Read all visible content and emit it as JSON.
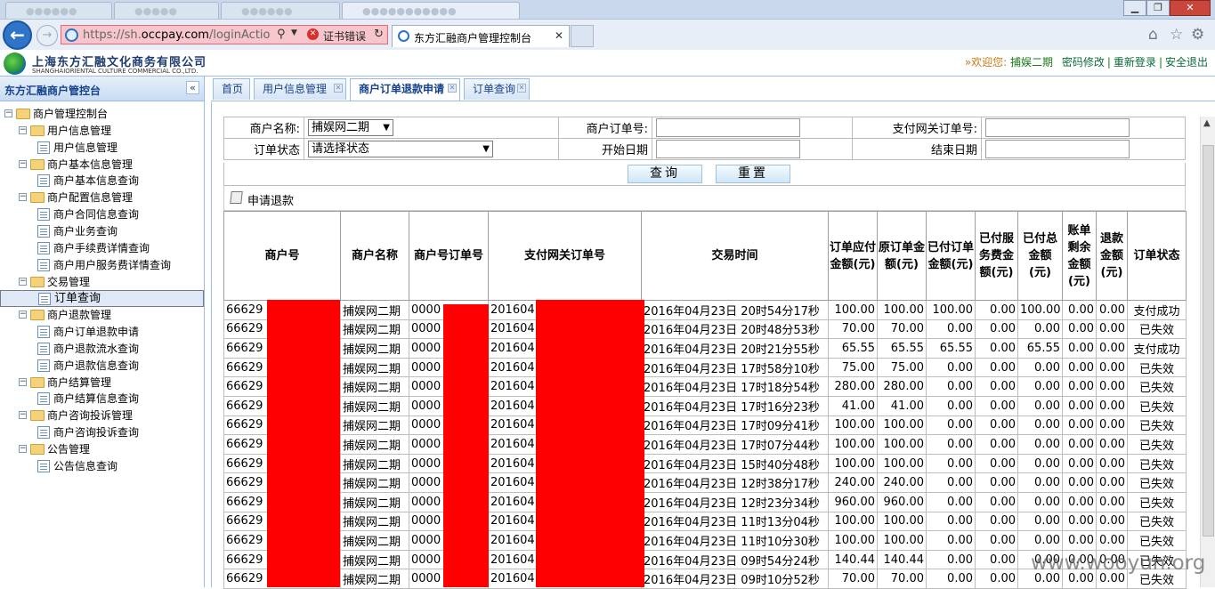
{
  "browser": {
    "url_prefix": "https://sh.",
    "url_domain": "occpay.com",
    "url_rest": "/loginAction.ac",
    "cert_error": "证书错误",
    "tab_title": "东方汇融商户管理控制台"
  },
  "header": {
    "company_cn": "上海东方汇融文化商务有限公司",
    "company_en": "SHANGHAIORIENTAL CULTURE COMMERCIAL CO.,LTD.",
    "welcome_label": "»欢迎您: ",
    "username": "捕娱二期",
    "links": [
      "密码修改",
      "重新登录",
      "安全退出"
    ]
  },
  "sidebar": {
    "title": "东方汇融商户管控台",
    "collapse_glyph": "«",
    "nodes": [
      {
        "label": "商户管理控制台",
        "level": 0,
        "type": "folder"
      },
      {
        "label": "用户信息管理",
        "level": 1,
        "type": "folder"
      },
      {
        "label": "用户信息管理",
        "level": 2,
        "type": "page"
      },
      {
        "label": "商户基本信息管理",
        "level": 1,
        "type": "folder"
      },
      {
        "label": "商户基本信息查询",
        "level": 2,
        "type": "page"
      },
      {
        "label": "商户配置信息管理",
        "level": 1,
        "type": "folder"
      },
      {
        "label": "商户合同信息查询",
        "level": 2,
        "type": "page"
      },
      {
        "label": "商户业务查询",
        "level": 2,
        "type": "page"
      },
      {
        "label": "商户手续费详情查询",
        "level": 2,
        "type": "page"
      },
      {
        "label": "商户用户服务费详情查询",
        "level": 2,
        "type": "page"
      },
      {
        "label": "交易管理",
        "level": 1,
        "type": "folder"
      },
      {
        "label": "订单查询",
        "level": 2,
        "type": "page",
        "selected": true
      },
      {
        "label": "商户退款管理",
        "level": 1,
        "type": "folder"
      },
      {
        "label": "商户订单退款申请",
        "level": 2,
        "type": "page"
      },
      {
        "label": "商户退款流水查询",
        "level": 2,
        "type": "page"
      },
      {
        "label": "商户退款信息查询",
        "level": 2,
        "type": "page"
      },
      {
        "label": "商户结算管理",
        "level": 1,
        "type": "folder"
      },
      {
        "label": "商户结算信息查询",
        "level": 2,
        "type": "page"
      },
      {
        "label": "商户咨询投诉管理",
        "level": 1,
        "type": "folder"
      },
      {
        "label": "商户咨询投诉查询",
        "level": 2,
        "type": "page"
      },
      {
        "label": "公告管理",
        "level": 1,
        "type": "folder"
      },
      {
        "label": "公告信息查询",
        "level": 2,
        "type": "page"
      }
    ]
  },
  "tabs": [
    {
      "label": "首页",
      "closable": false,
      "active": false
    },
    {
      "label": "用户信息管理",
      "closable": true,
      "active": false
    },
    {
      "label": "商户订单退款申请",
      "closable": true,
      "active": true
    },
    {
      "label": "订单查询",
      "closable": true,
      "active": false
    }
  ],
  "query": {
    "merchant_name_label": "商户名称:",
    "merchant_name_value": "捕娱网二期",
    "merchant_order_label": "商户订单号:",
    "gateway_order_label": "支付网关订单号:",
    "order_status_label": "订单状态",
    "order_status_value": "请选择状态",
    "start_date_label": "开始日期",
    "end_date_label": "结束日期",
    "search_button": "查询",
    "reset_button": "重置"
  },
  "refund_request": {
    "label": "申请退款"
  },
  "grid": {
    "columns": [
      "商户号",
      "商户名称",
      "商户号订单号",
      "支付网关订单号",
      "交易时间",
      "订单应付金额(元)",
      "原订单金额(元)",
      "已付订单金额(元)",
      "已付服务费金额(元)",
      "已付总金额(元)",
      "账单剩余金额(元)",
      "退款金额(元)",
      "订单状态"
    ],
    "rows": [
      [
        "66629",
        "捕娱网二期",
        "0000",
        "201604",
        "2016年04月23日 20时54分17秒",
        "100.00",
        "100.00",
        "100.00",
        "0.00",
        "100.00",
        "0.00",
        "0.00",
        "支付成功"
      ],
      [
        "66629",
        "捕娱网二期",
        "0000",
        "201604",
        "2016年04月23日 20时48分53秒",
        "70.00",
        "70.00",
        "0.00",
        "0.00",
        "0.00",
        "0.00",
        "0.00",
        "已失效"
      ],
      [
        "66629",
        "捕娱网二期",
        "0000",
        "201604",
        "2016年04月23日 20时21分55秒",
        "65.55",
        "65.55",
        "65.55",
        "0.00",
        "65.55",
        "0.00",
        "0.00",
        "支付成功"
      ],
      [
        "66629",
        "捕娱网二期",
        "0000",
        "201604",
        "2016年04月23日 17时58分10秒",
        "75.00",
        "75.00",
        "0.00",
        "0.00",
        "0.00",
        "0.00",
        "0.00",
        "已失效"
      ],
      [
        "66629",
        "捕娱网二期",
        "0000",
        "201604",
        "2016年04月23日 17时18分54秒",
        "280.00",
        "280.00",
        "0.00",
        "0.00",
        "0.00",
        "0.00",
        "0.00",
        "已失效"
      ],
      [
        "66629",
        "捕娱网二期",
        "0000",
        "201604",
        "2016年04月23日 17时16分23秒",
        "41.00",
        "41.00",
        "0.00",
        "0.00",
        "0.00",
        "0.00",
        "0.00",
        "已失效"
      ],
      [
        "66629",
        "捕娱网二期",
        "0000",
        "201604",
        "2016年04月23日 17时09分41秒",
        "100.00",
        "100.00",
        "0.00",
        "0.00",
        "0.00",
        "0.00",
        "0.00",
        "已失效"
      ],
      [
        "66629",
        "捕娱网二期",
        "0000",
        "201604",
        "2016年04月23日 17时07分44秒",
        "100.00",
        "100.00",
        "0.00",
        "0.00",
        "0.00",
        "0.00",
        "0.00",
        "已失效"
      ],
      [
        "66629",
        "捕娱网二期",
        "0000",
        "201604",
        "2016年04月23日 15时40分48秒",
        "100.00",
        "100.00",
        "0.00",
        "0.00",
        "0.00",
        "0.00",
        "0.00",
        "已失效"
      ],
      [
        "66629",
        "捕娱网二期",
        "0000",
        "201604",
        "2016年04月23日 12时38分17秒",
        "240.00",
        "240.00",
        "0.00",
        "0.00",
        "0.00",
        "0.00",
        "0.00",
        "已失效"
      ],
      [
        "66629",
        "捕娱网二期",
        "0000",
        "201604",
        "2016年04月23日 12时23分34秒",
        "960.00",
        "960.00",
        "0.00",
        "0.00",
        "0.00",
        "0.00",
        "0.00",
        "已失效"
      ],
      [
        "66629",
        "捕娱网二期",
        "0000",
        "201604",
        "2016年04月23日 11时13分04秒",
        "100.00",
        "100.00",
        "0.00",
        "0.00",
        "0.00",
        "0.00",
        "0.00",
        "已失效"
      ],
      [
        "66629",
        "捕娱网二期",
        "0000",
        "201604",
        "2016年04月23日 11时10分30秒",
        "100.00",
        "100.00",
        "0.00",
        "0.00",
        "0.00",
        "0.00",
        "0.00",
        "已失效"
      ],
      [
        "66629",
        "捕娱网二期",
        "0000",
        "201604",
        "2016年04月23日 09时54分24秒",
        "140.44",
        "140.44",
        "0.00",
        "0.00",
        "0.00",
        "0.00",
        "0.00",
        "已失效"
      ],
      [
        "66629",
        "捕娱网二期",
        "0000",
        "201604",
        "2016年04月23日 09时10分52秒",
        "70.00",
        "70.00",
        "0.00",
        "0.00",
        "0.00",
        "0.00",
        "0.00",
        "已失效"
      ]
    ]
  },
  "watermark": "www.wooyun.org",
  "colors": {
    "redaction": "#ff0000",
    "link_green": "#0d6a3c",
    "welcome_orange": "#c97a12",
    "panel_blue": "#15428b"
  }
}
